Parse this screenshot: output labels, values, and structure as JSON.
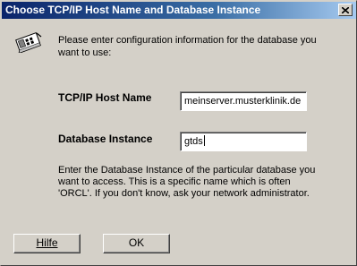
{
  "window": {
    "title": "Choose TCP/IP Host Name and Database Instance"
  },
  "intro_text": "Please enter configuration information for the database you want to use:",
  "host": {
    "label": "TCP/IP Host Name",
    "value": "meinserver.musterklinik.de"
  },
  "database": {
    "label": "Database Instance",
    "value": "gtds"
  },
  "help_text": "Enter the Database Instance of the particular database you want to access.  This is a specific name which is often 'ORCL'.  If you don't know, ask your network administrator.",
  "buttons": {
    "help_label": "Hilfe",
    "ok_label": "OK"
  },
  "icons": {
    "dialog": "network-card-icon",
    "close": "close-icon"
  },
  "colors": {
    "titlebar_start": "#0a246a",
    "titlebar_end": "#a6caf0",
    "face": "#d4d0c8"
  }
}
